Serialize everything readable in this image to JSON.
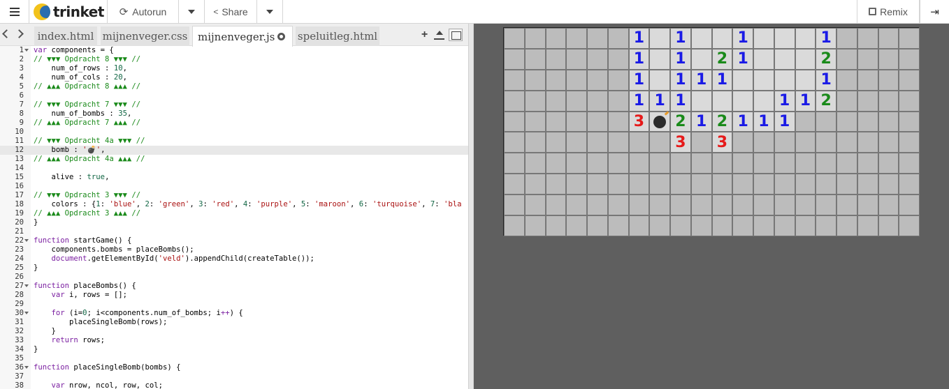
{
  "topbar": {
    "logo": "trinket",
    "autorun": "Autorun",
    "share": "Share",
    "remix": "Remix"
  },
  "tabs": [
    {
      "label": "index.html",
      "active": false
    },
    {
      "label": "mijnenveger.css",
      "active": false
    },
    {
      "label": "mijnenveger.js",
      "active": true
    },
    {
      "label": "speluitleg.html",
      "active": false
    }
  ],
  "code_lines": [
    {
      "n": "1",
      "fold": true,
      "html": "<span class=\"kw\">var</span> components = {"
    },
    {
      "n": "2",
      "html": "<span class=\"cm\">// ▼▼▼ Opdracht 8 ▼▼▼ //</span>"
    },
    {
      "n": "3",
      "html": "    num_of_rows : <span class=\"nm\">10</span>,"
    },
    {
      "n": "4",
      "html": "    num_of_cols : <span class=\"nm\">20</span>,"
    },
    {
      "n": "5",
      "html": "<span class=\"cm\">// ▲▲▲ Opdracht 8 ▲▲▲ //</span>"
    },
    {
      "n": "6",
      "html": ""
    },
    {
      "n": "7",
      "html": "<span class=\"cm\">// ▼▼▼ Opdracht 7 ▼▼▼ //</span>"
    },
    {
      "n": "8",
      "html": "    num_of_bombs : <span class=\"nm\">35</span>,"
    },
    {
      "n": "9",
      "html": "<span class=\"cm\">// ▲▲▲ Opdracht 7 ▲▲▲ //</span>"
    },
    {
      "n": "10",
      "html": ""
    },
    {
      "n": "11",
      "html": "<span class=\"cm\">// ▼▼▼ Opdracht 4a ▼▼▼ //</span>"
    },
    {
      "n": "12",
      "hl": true,
      "html": "    bomb : <span class=\"st\">'💣'</span>,"
    },
    {
      "n": "13",
      "html": "<span class=\"cm\">// ▲▲▲ Opdracht 4a ▲▲▲ //</span>"
    },
    {
      "n": "14",
      "html": ""
    },
    {
      "n": "15",
      "html": "    alive : <span class=\"nm\">true</span>,"
    },
    {
      "n": "16",
      "html": ""
    },
    {
      "n": "17",
      "html": "<span class=\"cm\">// ▼▼▼ Opdracht 3 ▼▼▼ //</span>"
    },
    {
      "n": "18",
      "html": "    colors : {<span class=\"nm\">1</span>: <span class=\"st\">'blue'</span>, <span class=\"nm\">2</span>: <span class=\"st\">'green'</span>, <span class=\"nm\">3</span>: <span class=\"st\">'red'</span>, <span class=\"nm\">4</span>: <span class=\"st\">'purple'</span>, <span class=\"nm\">5</span>: <span class=\"st\">'maroon'</span>, <span class=\"nm\">6</span>: <span class=\"st\">'turquoise'</span>, <span class=\"nm\">7</span>: <span class=\"st\">'bla</span>"
    },
    {
      "n": "19",
      "html": "<span class=\"cm\">// ▲▲▲ Opdracht 3 ▲▲▲ //</span>"
    },
    {
      "n": "20",
      "html": "}"
    },
    {
      "n": "21",
      "html": ""
    },
    {
      "n": "22",
      "fold": true,
      "html": "<span class=\"kw\">function</span> startGame() {"
    },
    {
      "n": "23",
      "html": "    components.bombs = placeBombs();"
    },
    {
      "n": "24",
      "html": "    <span class=\"kw\">document</span>.getElementById(<span class=\"st\">'veld'</span>).appendChild(createTable());"
    },
    {
      "n": "25",
      "html": "}"
    },
    {
      "n": "26",
      "html": ""
    },
    {
      "n": "27",
      "fold": true,
      "html": "<span class=\"kw\">function</span> placeBombs() {"
    },
    {
      "n": "28",
      "html": "    <span class=\"kw\">var</span> i, rows = [];"
    },
    {
      "n": "29",
      "html": ""
    },
    {
      "n": "30",
      "fold": true,
      "html": "    <span class=\"kw\">for</span> (i=<span class=\"nm\">0</span>; i&lt;components.num_of_bombs; i<span class=\"kw\">++</span>) {"
    },
    {
      "n": "31",
      "html": "        placeSingleBomb(rows);"
    },
    {
      "n": "32",
      "html": "    }"
    },
    {
      "n": "33",
      "html": "    <span class=\"kw\">return</span> rows;"
    },
    {
      "n": "34",
      "html": "}"
    },
    {
      "n": "35",
      "html": ""
    },
    {
      "n": "36",
      "fold": true,
      "html": "<span class=\"kw\">function</span> placeSingleBomb(bombs) {"
    },
    {
      "n": "37",
      "html": ""
    },
    {
      "n": "38",
      "html": "    <span class=\"kw\">var</span> nrow, ncol, row, col;"
    }
  ],
  "board": {
    "rows": 10,
    "cols": 20,
    "cells": [
      [
        "",
        "",
        "",
        "",
        "",
        "",
        "1",
        "o",
        "1",
        "o",
        "o",
        "1",
        "o",
        "o",
        "o",
        "1",
        "",
        "",
        "",
        ""
      ],
      [
        "",
        "",
        "",
        "",
        "",
        "",
        "1",
        "o",
        "1",
        "o",
        "2",
        "1",
        "o",
        "o",
        "o",
        "2",
        "",
        "",
        "",
        ""
      ],
      [
        "",
        "",
        "",
        "",
        "",
        "",
        "1",
        "o",
        "1",
        "1",
        "1",
        "o",
        "o",
        "o",
        "o",
        "1",
        "",
        "",
        "",
        ""
      ],
      [
        "",
        "",
        "",
        "",
        "",
        "",
        "1",
        "1",
        "1",
        "o",
        "o",
        "o",
        "o",
        "1",
        "1",
        "2",
        "",
        "",
        "",
        ""
      ],
      [
        "",
        "",
        "",
        "",
        "",
        "",
        "3",
        "B",
        "2",
        "1",
        "2",
        "1",
        "1",
        "1",
        "",
        "",
        "",
        "",
        "",
        ""
      ],
      [
        "",
        "",
        "",
        "",
        "",
        "",
        "",
        "",
        "3",
        "",
        "3",
        "",
        "",
        "",
        "",
        "",
        "",
        "",
        "",
        ""
      ],
      [
        "",
        "",
        "",
        "",
        "",
        "",
        "",
        "",
        "",
        "",
        "",
        "",
        "",
        "",
        "",
        "",
        "",
        "",
        "",
        ""
      ],
      [
        "",
        "",
        "",
        "",
        "",
        "",
        "",
        "",
        "",
        "",
        "",
        "",
        "",
        "",
        "",
        "",
        "",
        "",
        "",
        ""
      ],
      [
        "",
        "",
        "",
        "",
        "",
        "",
        "",
        "",
        "",
        "",
        "",
        "",
        "",
        "",
        "",
        "",
        "",
        "",
        "",
        ""
      ],
      [
        "",
        "",
        "",
        "",
        "",
        "",
        "",
        "",
        "",
        "",
        "",
        "",
        "",
        "",
        "",
        "",
        "",
        "",
        "",
        ""
      ]
    ],
    "number_colors": {
      "1": "#1a1ae6",
      "2": "#1a8a1a",
      "3": "#e61a1a"
    }
  }
}
